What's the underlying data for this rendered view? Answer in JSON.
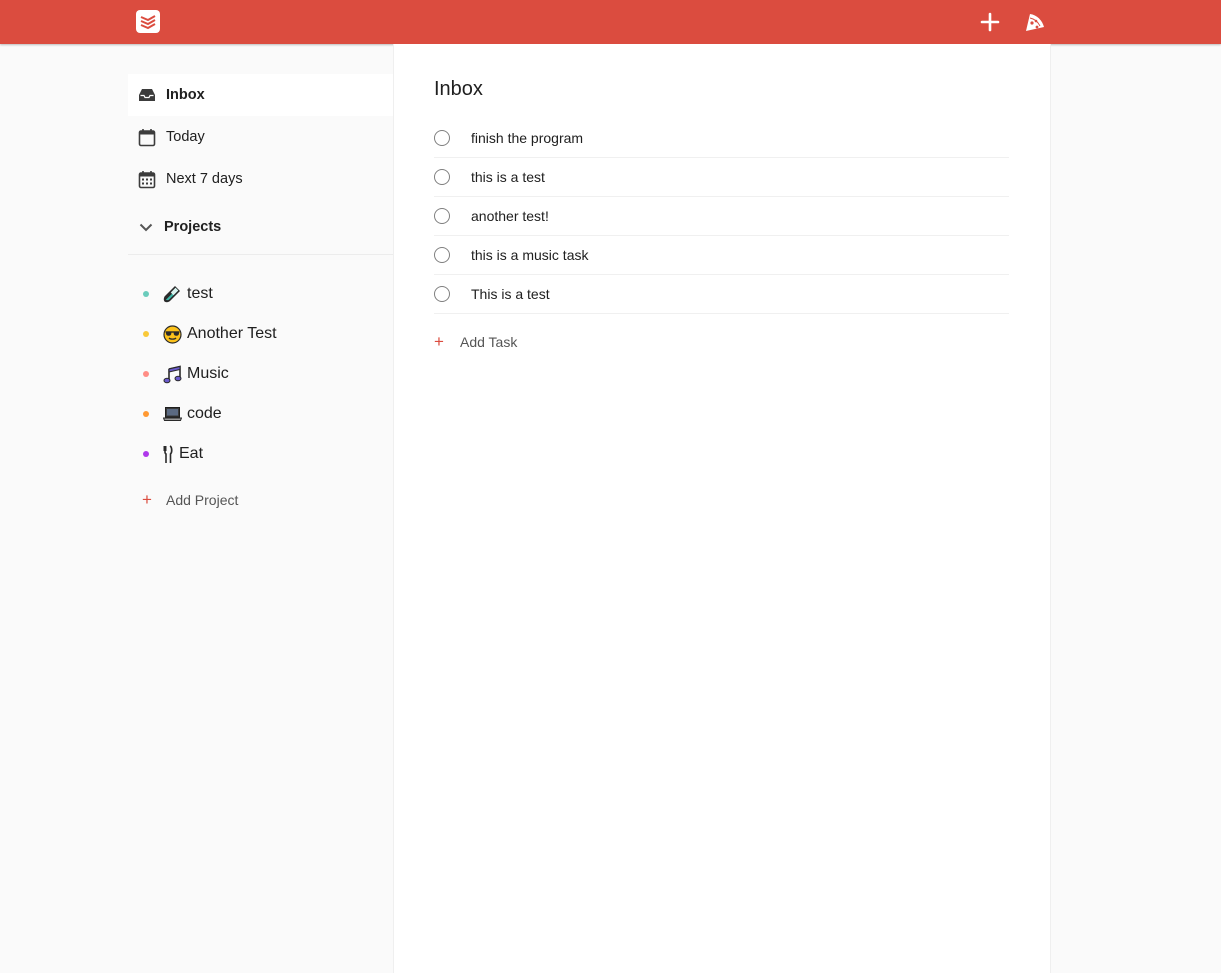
{
  "header": {
    "logo_icon": "todoist-logo-icon",
    "add_icon": "plus-icon",
    "karma_icon": "productivity-icon",
    "bar_color": "#db4c3f"
  },
  "sidebar": {
    "nav": [
      {
        "label": "Inbox",
        "icon": "inbox-icon",
        "active": true
      },
      {
        "label": "Today",
        "icon": "calendar-icon"
      },
      {
        "label": "Next 7 days",
        "icon": "calendar-week-icon"
      }
    ],
    "projects_label": "Projects",
    "projects": [
      {
        "emoji": "🧪",
        "label": "test",
        "color": "#6accbc"
      },
      {
        "emoji": "😎",
        "label": "Another Test",
        "color": "#f9c939"
      },
      {
        "emoji": "🎵",
        "label": "Music",
        "color": "#ff8d85"
      },
      {
        "emoji": "💻",
        "label": "code",
        "color": "#ff9933"
      },
      {
        "emoji": "🍴",
        "label": "Eat",
        "color": "#af38eb"
      }
    ],
    "add_project_label": "Add Project"
  },
  "main": {
    "title": "Inbox",
    "tasks": [
      {
        "label": "finish the program"
      },
      {
        "label": "this is a test"
      },
      {
        "label": "another test!"
      },
      {
        "label": "this is a music task"
      },
      {
        "label": "This is a test"
      }
    ],
    "add_task_label": "Add Task"
  }
}
